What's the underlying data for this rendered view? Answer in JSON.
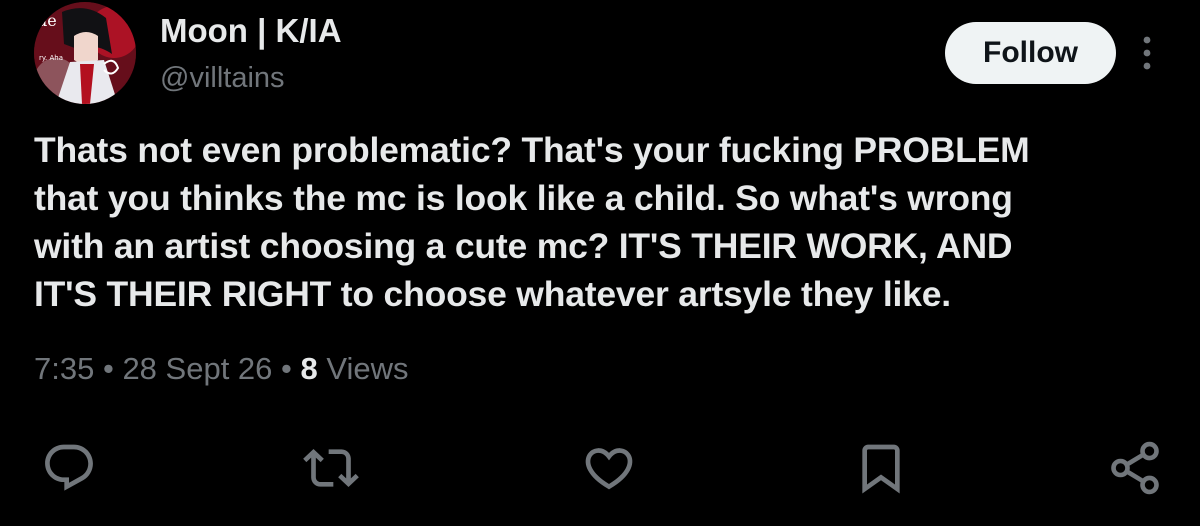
{
  "colors": {
    "background": "#000000",
    "primary_text": "#e7e9ea",
    "secondary_text": "#71767b",
    "follow_bg": "#eff3f4",
    "follow_text": "#0f1419"
  },
  "author": {
    "display_name": "Moon | K/IA",
    "handle": "@villtains",
    "avatar_icon": "anime-character-avatar"
  },
  "follow_button": {
    "label": "Follow"
  },
  "more_button": {
    "icon": "more-vertical-icon"
  },
  "post": {
    "text": "Thats not even problematic? That's your fucking PROBLEM\nthat you thinks the mc is look like a child. So what's wrong\nwith an artist choosing a cute mc? IT'S THEIR WORK, AND\nIT'S THEIR RIGHT to choose whatever artsyle they like."
  },
  "meta": {
    "time": "7:35",
    "separator": " • ",
    "date": "28 Sept 26",
    "views_count": "8",
    "views_label": "Views"
  },
  "actions": [
    {
      "name": "reply",
      "icon": "reply-icon"
    },
    {
      "name": "repost",
      "icon": "repost-icon"
    },
    {
      "name": "like",
      "icon": "heart-icon"
    },
    {
      "name": "bookmark",
      "icon": "bookmark-icon"
    },
    {
      "name": "share",
      "icon": "share-icon"
    }
  ]
}
